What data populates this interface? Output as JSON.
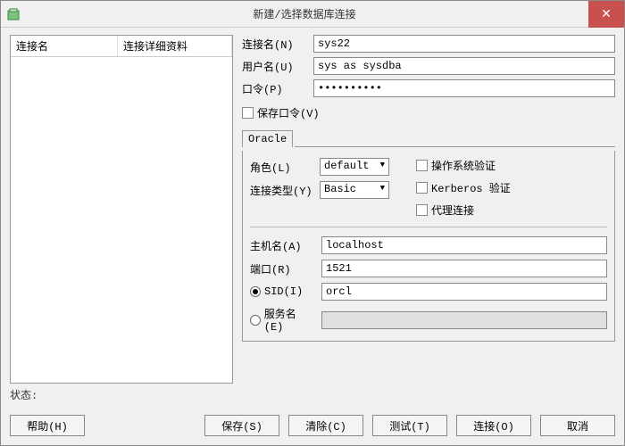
{
  "title": "新建/选择数据库连接",
  "list": {
    "col1": "连接名",
    "col2": "连接详细资料"
  },
  "status_label": "状态:",
  "form": {
    "conn_name_label": "连接名(N)",
    "conn_name": "sys22",
    "username_label": "用户名(U)",
    "username": "sys as sysdba",
    "password_label": "口令(P)",
    "password": "••••••••••",
    "save_pw_label": "保存口令(V)"
  },
  "tab": {
    "oracle": "Oracle"
  },
  "oracle": {
    "role_label": "角色(L)",
    "role": "default",
    "conntype_label": "连接类型(Y)",
    "conntype": "Basic",
    "osauth_label": "操作系统验证",
    "kerberos_label": "Kerberos 验证",
    "proxy_label": "代理连接",
    "hostname_label": "主机名(A)",
    "hostname": "localhost",
    "port_label": "端口(R)",
    "port": "1521",
    "sid_label": "SID(I)",
    "sid": "orcl",
    "servicename_label": "服务名(E)",
    "servicename": ""
  },
  "buttons": {
    "help": "帮助(H)",
    "save": "保存(S)",
    "clear": "清除(C)",
    "test": "测试(T)",
    "connect": "连接(O)",
    "cancel": "取消"
  }
}
